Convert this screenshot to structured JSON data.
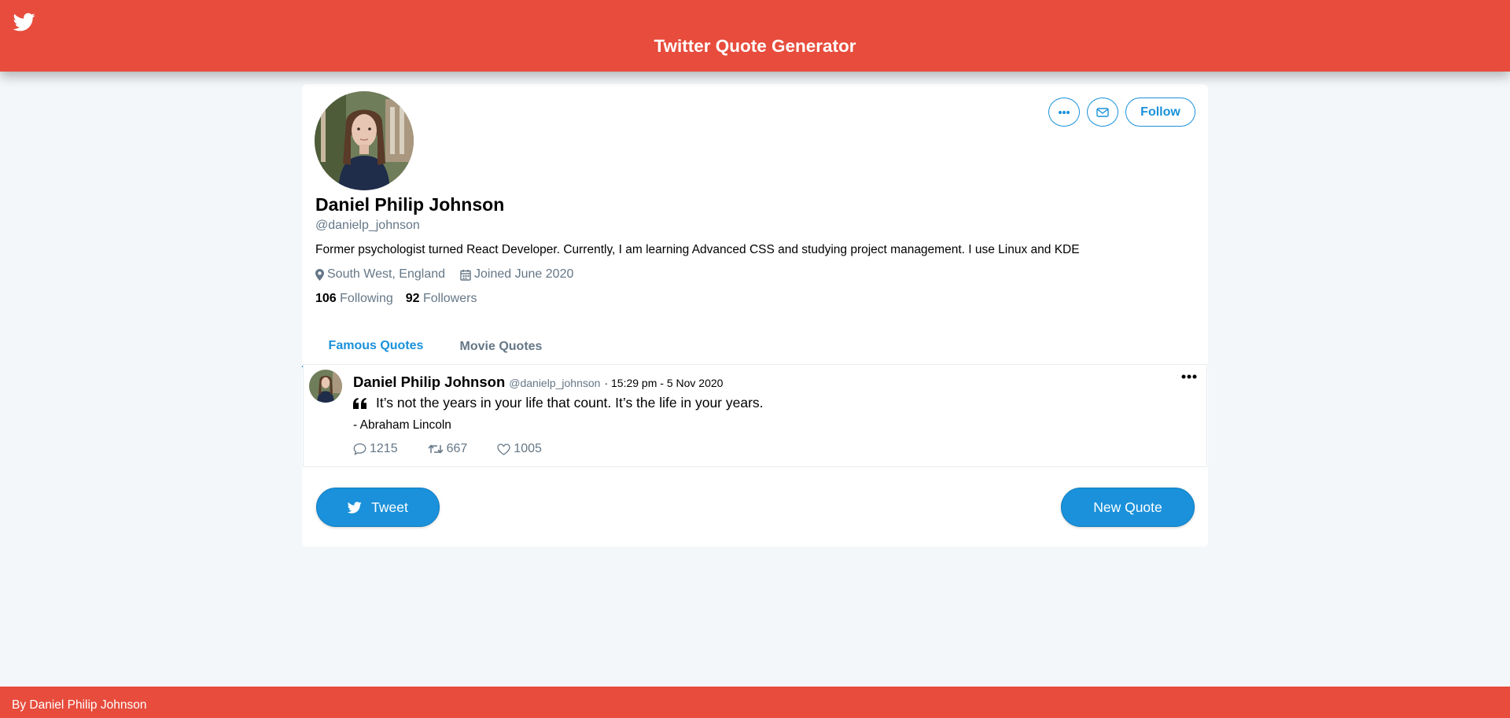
{
  "header": {
    "title": "Twitter Quote Generator",
    "logo_icon": "twitter-bird-icon"
  },
  "profile": {
    "name": "Daniel Philip Johnson",
    "handle": "@danielp_johnson",
    "bio": "Former psychologist turned React Developer. Currently, I am learning Advanced CSS and studying project management. I use Linux and KDE",
    "location": "South West, England",
    "joined": "Joined June 2020",
    "following_count": "106",
    "following_label": "Following",
    "followers_count": "92",
    "followers_label": "Followers",
    "follow_label": "Follow"
  },
  "tabs": [
    {
      "label": "Famous Quotes",
      "active": true
    },
    {
      "label": "Movie Quotes",
      "active": false
    }
  ],
  "tweet": {
    "name": "Daniel Philip Johnson",
    "handle": "@danielp_johnson",
    "time": "· 15:29 pm - 5 Nov 2020",
    "quote": "It’s not the years in your life that count. It’s the life in your years.",
    "author": "- Abraham Lincoln",
    "replies": "1215",
    "retweets": "667",
    "likes": "1005"
  },
  "buttons": {
    "tweet_label": "Tweet",
    "new_quote_label": "New Quote"
  },
  "footer": {
    "text": "By Daniel Philip Johnson"
  },
  "colors": {
    "header": "#e74c3c",
    "accent": "#1a91da",
    "muted": "#657786",
    "background": "#f4f7f9"
  }
}
